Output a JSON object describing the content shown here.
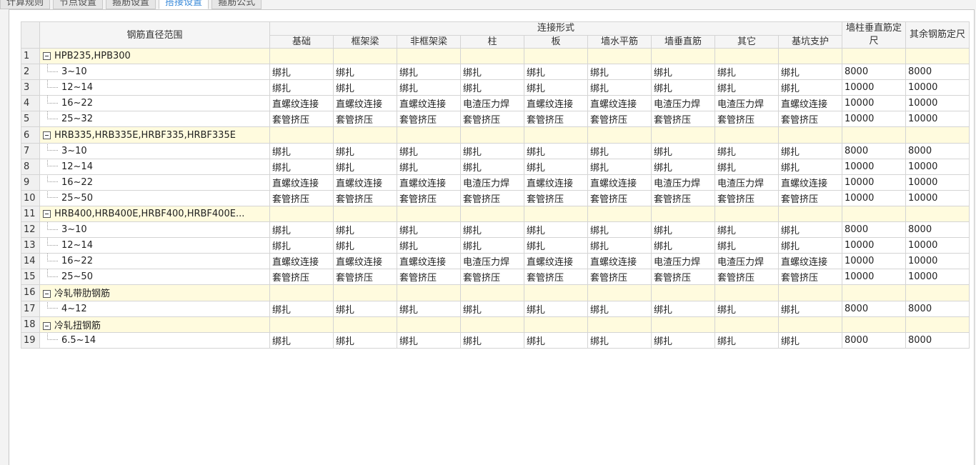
{
  "tabs": [
    {
      "label": "计算规则",
      "active": false
    },
    {
      "label": "节点设置",
      "active": false
    },
    {
      "label": "箍筋设置",
      "active": false
    },
    {
      "label": "搭接设置",
      "active": true
    },
    {
      "label": "箍筋公式",
      "active": false
    }
  ],
  "table": {
    "range_header": "钢筋直径范围",
    "conn_group_header": "连接形式",
    "conn_columns": [
      "基础",
      "框架梁",
      "非框架梁",
      "柱",
      "板",
      "墙水平筋",
      "墙垂直筋",
      "其它",
      "基坑支护"
    ],
    "wall_len_header": "墙柱垂直筋定尺",
    "other_len_header": "其余钢筋定尺",
    "rows": [
      {
        "num": "1",
        "group": true,
        "label": "HPB235,HPB300"
      },
      {
        "num": "2",
        "group": false,
        "label": "3~10",
        "conns": [
          "绑扎",
          "绑扎",
          "绑扎",
          "绑扎",
          "绑扎",
          "绑扎",
          "绑扎",
          "绑扎",
          "绑扎"
        ],
        "wall": "8000",
        "other": "8000"
      },
      {
        "num": "3",
        "group": false,
        "label": "12~14",
        "conns": [
          "绑扎",
          "绑扎",
          "绑扎",
          "绑扎",
          "绑扎",
          "绑扎",
          "绑扎",
          "绑扎",
          "绑扎"
        ],
        "wall": "10000",
        "other": "10000"
      },
      {
        "num": "4",
        "group": false,
        "label": "16~22",
        "conns": [
          "直螺纹连接",
          "直螺纹连接",
          "直螺纹连接",
          "电渣压力焊",
          "直螺纹连接",
          "直螺纹连接",
          "电渣压力焊",
          "电渣压力焊",
          "直螺纹连接"
        ],
        "wall": "10000",
        "other": "10000"
      },
      {
        "num": "5",
        "group": false,
        "label": "25~32",
        "last": true,
        "conns": [
          "套管挤压",
          "套管挤压",
          "套管挤压",
          "套管挤压",
          "套管挤压",
          "套管挤压",
          "套管挤压",
          "套管挤压",
          "套管挤压"
        ],
        "wall": "10000",
        "other": "10000"
      },
      {
        "num": "6",
        "group": true,
        "label": "HRB335,HRB335E,HRBF335,HRBF335E"
      },
      {
        "num": "7",
        "group": false,
        "label": "3~10",
        "conns": [
          "绑扎",
          "绑扎",
          "绑扎",
          "绑扎",
          "绑扎",
          "绑扎",
          "绑扎",
          "绑扎",
          "绑扎"
        ],
        "wall": "8000",
        "other": "8000"
      },
      {
        "num": "8",
        "group": false,
        "label": "12~14",
        "conns": [
          "绑扎",
          "绑扎",
          "绑扎",
          "绑扎",
          "绑扎",
          "绑扎",
          "绑扎",
          "绑扎",
          "绑扎"
        ],
        "wall": "10000",
        "other": "10000"
      },
      {
        "num": "9",
        "group": false,
        "label": "16~22",
        "conns": [
          "直螺纹连接",
          "直螺纹连接",
          "直螺纹连接",
          "电渣压力焊",
          "直螺纹连接",
          "直螺纹连接",
          "电渣压力焊",
          "电渣压力焊",
          "直螺纹连接"
        ],
        "wall": "10000",
        "other": "10000"
      },
      {
        "num": "10",
        "group": false,
        "label": "25~50",
        "last": true,
        "conns": [
          "套管挤压",
          "套管挤压",
          "套管挤压",
          "套管挤压",
          "套管挤压",
          "套管挤压",
          "套管挤压",
          "套管挤压",
          "套管挤压"
        ],
        "wall": "10000",
        "other": "10000"
      },
      {
        "num": "11",
        "group": true,
        "label": "HRB400,HRB400E,HRBF400,HRBF400E..."
      },
      {
        "num": "12",
        "group": false,
        "label": "3~10",
        "conns": [
          "绑扎",
          "绑扎",
          "绑扎",
          "绑扎",
          "绑扎",
          "绑扎",
          "绑扎",
          "绑扎",
          "绑扎"
        ],
        "wall": "8000",
        "other": "8000"
      },
      {
        "num": "13",
        "group": false,
        "label": "12~14",
        "conns": [
          "绑扎",
          "绑扎",
          "绑扎",
          "绑扎",
          "绑扎",
          "绑扎",
          "绑扎",
          "绑扎",
          "绑扎"
        ],
        "wall": "10000",
        "other": "10000"
      },
      {
        "num": "14",
        "group": false,
        "label": "16~22",
        "conns": [
          "直螺纹连接",
          "直螺纹连接",
          "直螺纹连接",
          "电渣压力焊",
          "直螺纹连接",
          "直螺纹连接",
          "电渣压力焊",
          "电渣压力焊",
          "直螺纹连接"
        ],
        "wall": "10000",
        "other": "10000"
      },
      {
        "num": "15",
        "group": false,
        "label": "25~50",
        "last": true,
        "conns": [
          "套管挤压",
          "套管挤压",
          "套管挤压",
          "套管挤压",
          "套管挤压",
          "套管挤压",
          "套管挤压",
          "套管挤压",
          "套管挤压"
        ],
        "wall": "10000",
        "other": "10000"
      },
      {
        "num": "16",
        "group": true,
        "label": "冷轧带肋钢筋"
      },
      {
        "num": "17",
        "group": false,
        "label": "4~12",
        "last": true,
        "conns": [
          "绑扎",
          "绑扎",
          "绑扎",
          "绑扎",
          "绑扎",
          "绑扎",
          "绑扎",
          "绑扎",
          "绑扎"
        ],
        "wall": "8000",
        "other": "8000"
      },
      {
        "num": "18",
        "group": true,
        "label": "冷轧扭钢筋"
      },
      {
        "num": "19",
        "group": false,
        "label": "6.5~14",
        "last": true,
        "conns": [
          "绑扎",
          "绑扎",
          "绑扎",
          "绑扎",
          "绑扎",
          "绑扎",
          "绑扎",
          "绑扎",
          "绑扎"
        ],
        "wall": "8000",
        "other": "8000"
      }
    ]
  },
  "colors": {
    "active_tab": "#3d8cd9",
    "group_row_bg": "#fffbde",
    "header_bg": "#f5f5f5"
  },
  "icons": {
    "group_toggle": "collapse-minus-icon"
  }
}
